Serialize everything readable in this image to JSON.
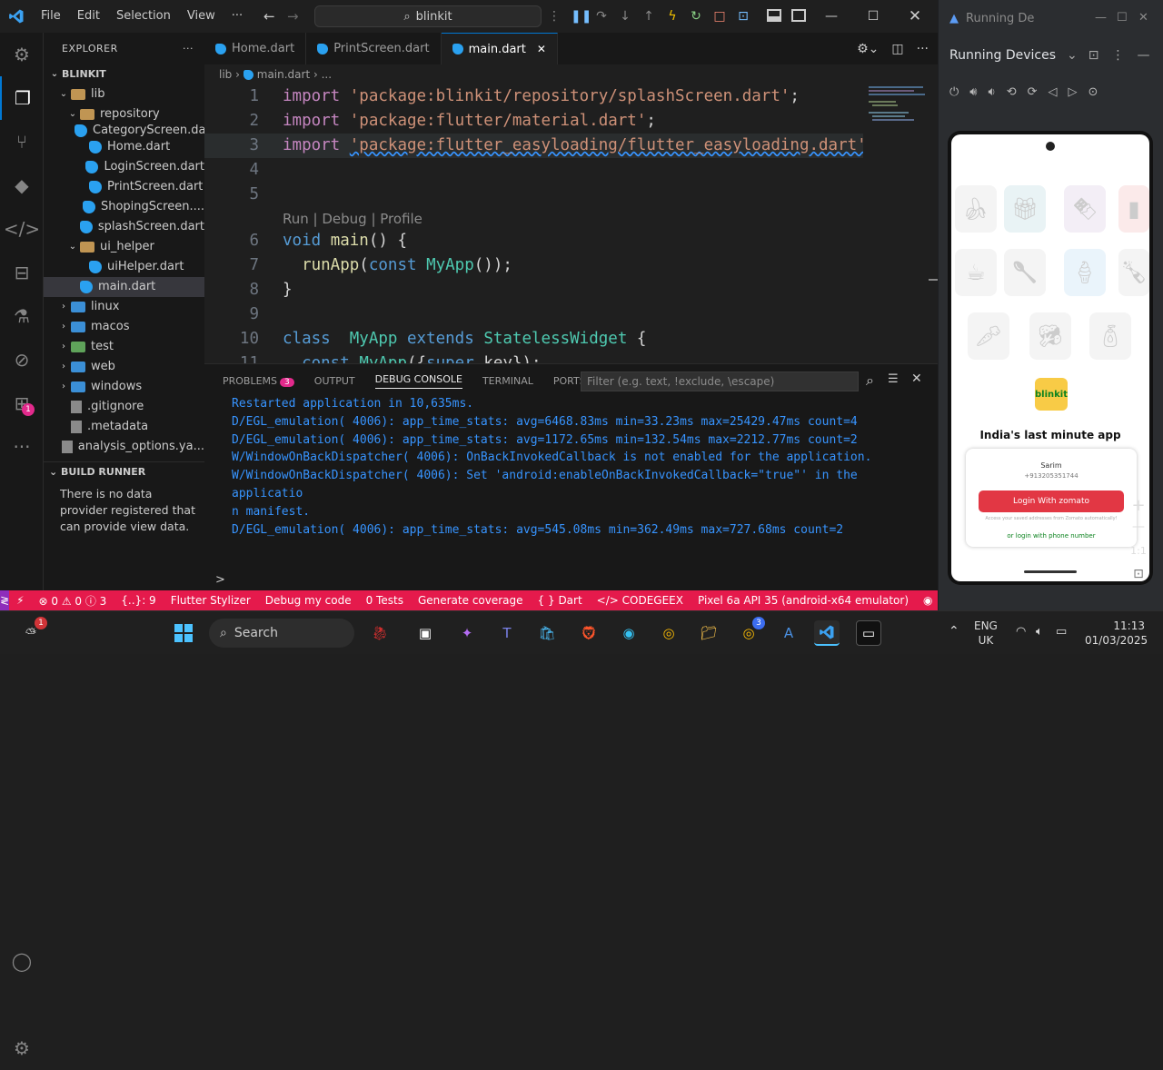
{
  "menu": [
    "File",
    "Edit",
    "Selection",
    "View",
    "···"
  ],
  "search": {
    "label": "blinkit"
  },
  "explorer": {
    "title": "EXPLORER",
    "project": "BLINKIT",
    "items": [
      {
        "label": "lib",
        "type": "folder-open",
        "depth": 1
      },
      {
        "label": "repository",
        "type": "folder-open",
        "depth": 2
      },
      {
        "label": "CategoryScreen.dart",
        "type": "dart",
        "depth": 3
      },
      {
        "label": "Home.dart",
        "type": "dart",
        "depth": 3
      },
      {
        "label": "LoginScreen.dart",
        "type": "dart",
        "depth": 3
      },
      {
        "label": "PrintScreen.dart",
        "type": "dart",
        "depth": 3
      },
      {
        "label": "ShopingScreen....",
        "type": "dart",
        "depth": 3
      },
      {
        "label": "splashScreen.dart",
        "type": "dart",
        "depth": 3
      },
      {
        "label": "ui_helper",
        "type": "folder-open",
        "depth": 2
      },
      {
        "label": "uiHelper.dart",
        "type": "dart",
        "depth": 3
      },
      {
        "label": "main.dart",
        "type": "dart",
        "depth": 2
      },
      {
        "label": "linux",
        "type": "folder",
        "depth": 1
      },
      {
        "label": "macos",
        "type": "folder",
        "depth": 1
      },
      {
        "label": "test",
        "type": "folder",
        "depth": 1
      },
      {
        "label": "web",
        "type": "folder",
        "depth": 1
      },
      {
        "label": "windows",
        "type": "folder",
        "depth": 1
      },
      {
        "label": ".gitignore",
        "type": "file",
        "depth": 1
      },
      {
        "label": ".metadata",
        "type": "file",
        "depth": 1
      },
      {
        "label": "analysis_options.ya...",
        "type": "file",
        "depth": 1
      }
    ],
    "build_runner": {
      "title": "BUILD RUNNER",
      "message": "There is no data provider registered that can provide view data."
    }
  },
  "tabs": [
    {
      "label": "Home.dart"
    },
    {
      "label": "PrintScreen.dart"
    },
    {
      "label": "main.dart",
      "active": true
    }
  ],
  "breadcrumb": {
    "folder": "lib",
    "file": "main.dart",
    "more": "..."
  },
  "code": {
    "lines": [
      {
        "n": "1",
        "tokens": [
          [
            "kw",
            "import"
          ],
          [
            "pun",
            " "
          ],
          [
            "str",
            "'package:blinkit/repository/splashScreen.dart'"
          ],
          [
            "pun",
            ";"
          ]
        ]
      },
      {
        "n": "2",
        "tokens": [
          [
            "kw",
            "import"
          ],
          [
            "pun",
            " "
          ],
          [
            "str",
            "'package:flutter/material.dart'"
          ],
          [
            "pun",
            ";"
          ]
        ]
      },
      {
        "n": "3",
        "tokens": [
          [
            "kw",
            "import"
          ],
          [
            "pun",
            " "
          ],
          [
            "str",
            "'package:flutter_easyloading/flutter_easyloading.dart'"
          ],
          [
            "pun",
            ";"
          ]
        ],
        "squiggle": true
      },
      {
        "n": "4",
        "tokens": []
      },
      {
        "n": "5",
        "tokens": []
      },
      {
        "n": "",
        "lens": "Run | Debug | Profile"
      },
      {
        "n": "6",
        "tokens": [
          [
            "kw2",
            "void"
          ],
          [
            "pun",
            " "
          ],
          [
            "fn",
            "main"
          ],
          [
            "pun",
            "() {"
          ]
        ]
      },
      {
        "n": "7",
        "tokens": [
          [
            "pun",
            "  "
          ],
          [
            "fn",
            "runApp"
          ],
          [
            "pun",
            "("
          ],
          [
            "kw2",
            "const"
          ],
          [
            "pun",
            " "
          ],
          [
            "cls",
            "MyApp"
          ],
          [
            "pun",
            "());"
          ]
        ]
      },
      {
        "n": "8",
        "tokens": [
          [
            "pun",
            "}"
          ]
        ]
      },
      {
        "n": "9",
        "tokens": []
      },
      {
        "n": "10",
        "tokens": [
          [
            "kw2",
            "class"
          ],
          [
            "pun",
            "  "
          ],
          [
            "cls",
            "MyApp"
          ],
          [
            "pun",
            " "
          ],
          [
            "kw2",
            "extends"
          ],
          [
            "pun",
            " "
          ],
          [
            "cls",
            "StatelessWidget"
          ],
          [
            "pun",
            " {"
          ]
        ]
      },
      {
        "n": "11",
        "tokens": [
          [
            "pun",
            "  "
          ],
          [
            "kw2",
            "const"
          ],
          [
            "pun",
            " "
          ],
          [
            "cls",
            "MyApp"
          ],
          [
            "pun",
            "({"
          ],
          [
            "kw2",
            "super"
          ],
          [
            "pun",
            "."
          ],
          [
            "pun",
            "key"
          ],
          [
            "pun",
            "});"
          ]
        ]
      }
    ]
  },
  "panel": {
    "tabs": [
      {
        "label": "PROBLEMS",
        "badge": "3"
      },
      {
        "label": "OUTPUT"
      },
      {
        "label": "DEBUG CONSOLE",
        "active": true
      },
      {
        "label": "TERMINAL"
      },
      {
        "label": "PORTS"
      }
    ],
    "filter_placeholder": "Filter (e.g. text, !exclude, \\escape)",
    "console": [
      "Restarted application in 10,635ms.",
      "D/EGL_emulation( 4006): app_time_stats: avg=6468.83ms min=33.23ms max=25429.47ms count=4",
      "D/EGL_emulation( 4006): app_time_stats: avg=1172.65ms min=132.54ms max=2212.77ms count=2",
      "W/WindowOnBackDispatcher( 4006): OnBackInvokedCallback is not enabled for the application.",
      "W/WindowOnBackDispatcher( 4006): Set 'android:enableOnBackInvokedCallback=\"true\"' in the applicatio",
      "n manifest.",
      "D/EGL_emulation( 4006): app_time_stats: avg=545.08ms min=362.49ms max=727.68ms count=2"
    ],
    "prompt": ">"
  },
  "status": {
    "items": [
      "⊗ 0 ⚠ 0 ⓘ 3",
      "{..}: 9",
      "Flutter Stylizer",
      "Debug my code",
      "0 Tests",
      "Generate coverage"
    ],
    "right": [
      "Dart",
      "CODEGEEX",
      "Pixel 6a API 35 (android-x64 emulator)"
    ]
  },
  "emulator": {
    "window_title": "Running De",
    "header": "Running Devices",
    "app": {
      "logo_text": "blinkit",
      "tagline": "India's last minute app",
      "user_name": "Sarim",
      "user_phone": "+913205351744",
      "login_button": "Login With zomato",
      "note": "Access your saved addresses from Zomato automatically!",
      "alt_login": "or login with phone number"
    },
    "zoom": "1:1"
  },
  "taskbar": {
    "search": "Search",
    "notif_badge": "1",
    "chrome_badge": "3",
    "lang": "ENG",
    "region": "UK",
    "time": "11:13",
    "date": "01/03/2025"
  },
  "colors": {
    "accent": "#0078d4",
    "status": "#e51a4c",
    "remote": "#8e2dbb",
    "badge": "#e22a8c",
    "zomato": "#e23744",
    "blinkit_yellow": "#f8cb46"
  }
}
